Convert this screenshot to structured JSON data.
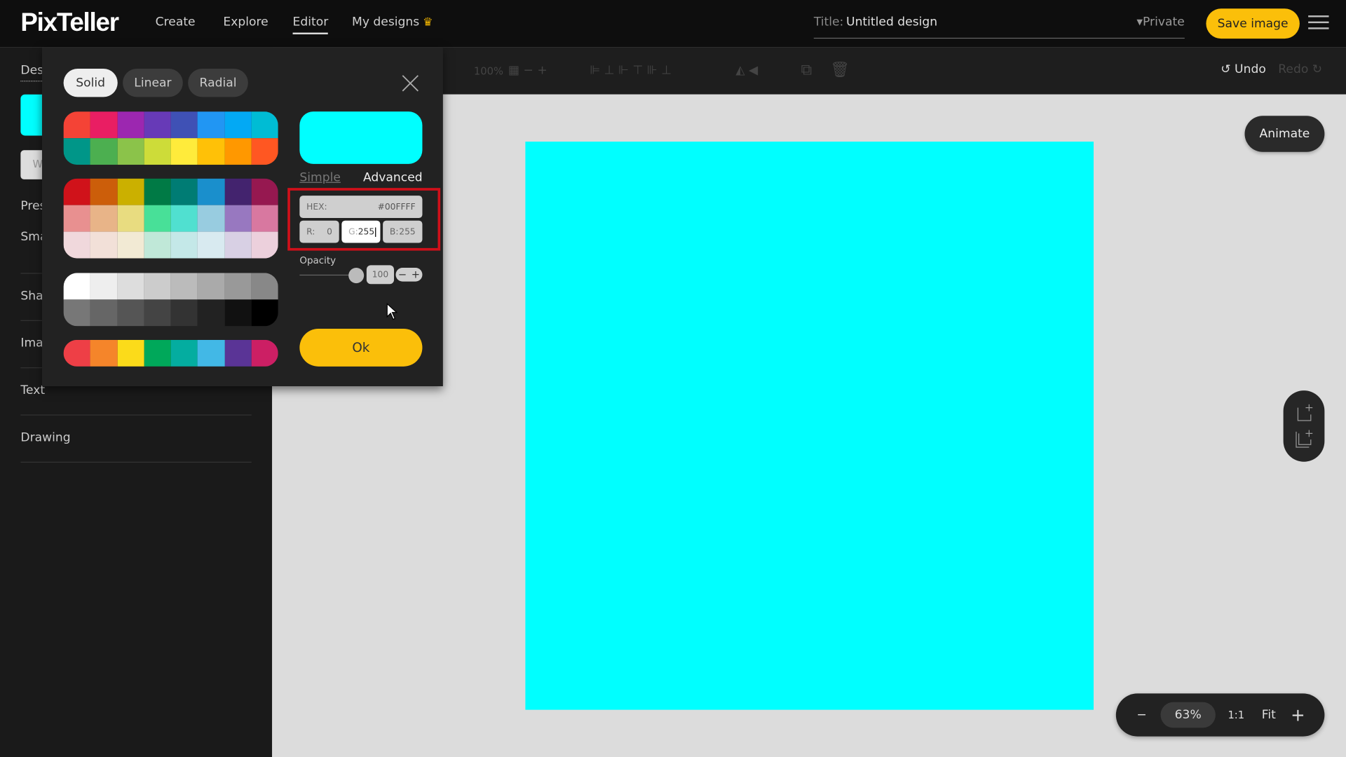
{
  "header": {
    "logo": "PixTeller",
    "nav": [
      {
        "label": "Create"
      },
      {
        "label": "Explore"
      },
      {
        "label": "Editor",
        "active": true
      },
      {
        "label": "My designs"
      }
    ],
    "title_label": "Title:",
    "title_value": "Untitled design",
    "privacy": "▾Private",
    "save_label": "Save image"
  },
  "sidebar": {
    "tab": "Des",
    "input_partial": "W",
    "items": [
      "Pres",
      "Sma",
      "Sha",
      "Ima",
      "Text",
      "Drawing"
    ]
  },
  "toolbar": {
    "zoom": "100%",
    "undo": "Undo",
    "redo": "Redo"
  },
  "canvas": {
    "fill": "#00ffff",
    "animate_label": "Animate"
  },
  "zoom_controls": {
    "minus": "−",
    "value": "63%",
    "one_to_one": "1:1",
    "fit": "Fit",
    "plus": "+"
  },
  "color_picker": {
    "tabs": [
      "Solid",
      "Linear",
      "Radial"
    ],
    "selected_tab": "Solid",
    "palettes": [
      [
        [
          "#f44336",
          "#e91e63",
          "#9c27b0",
          "#673ab7",
          "#3f51b5",
          "#2196f3",
          "#03a9f4",
          "#00bcd4"
        ],
        [
          "#009688",
          "#4caf50",
          "#8bc34a",
          "#cddc39",
          "#ffeb3b",
          "#ffc107",
          "#ff9800",
          "#ff5722"
        ]
      ],
      [
        [
          "#d0121a",
          "#cc5e0a",
          "#cbb000",
          "#007a45",
          "#007c74",
          "#1a8fcc",
          "#43236e",
          "#961850"
        ],
        [
          "#e89090",
          "#e8b488",
          "#e8dc80",
          "#48e098",
          "#50e0d0",
          "#98cce0",
          "#9878c0",
          "#d878a0"
        ],
        [
          "#f0d8dc",
          "#f2e0d8",
          "#f2ead4",
          "#c0e8d8",
          "#c4e8e8",
          "#d8eaf0",
          "#d8d0e4",
          "#ecd0dc"
        ]
      ],
      [
        [
          "#ffffff",
          "#eeeeee",
          "#dddddd",
          "#cccccc",
          "#bbbbbb",
          "#aaaaaa",
          "#999999",
          "#888888"
        ],
        [
          "#777777",
          "#666666",
          "#555555",
          "#444444",
          "#333333",
          "#222222",
          "#111111",
          "#000000"
        ]
      ],
      [
        [
          "#ee3f46",
          "#f5852a",
          "#fbdb1a",
          "#00a85a",
          "#04ada0",
          "#42b8e6",
          "#5a3496",
          "#cc1f64"
        ]
      ]
    ],
    "preview_color": "#00ffff",
    "mode_simple": "Simple",
    "mode_advanced": "Advanced",
    "hex_label": "HEX:",
    "hex_value": "#00FFFF",
    "r_label": "R:",
    "r_value": "0",
    "g_label": "G:",
    "g_value": "255",
    "b_label": "B:",
    "b_value": "255",
    "opacity_label": "Opacity",
    "opacity_value": "100",
    "opacity_percent": 100,
    "ok_label": "Ok"
  },
  "colors": {
    "accent": "#fbbf0a",
    "highlight": "#d0101a"
  }
}
